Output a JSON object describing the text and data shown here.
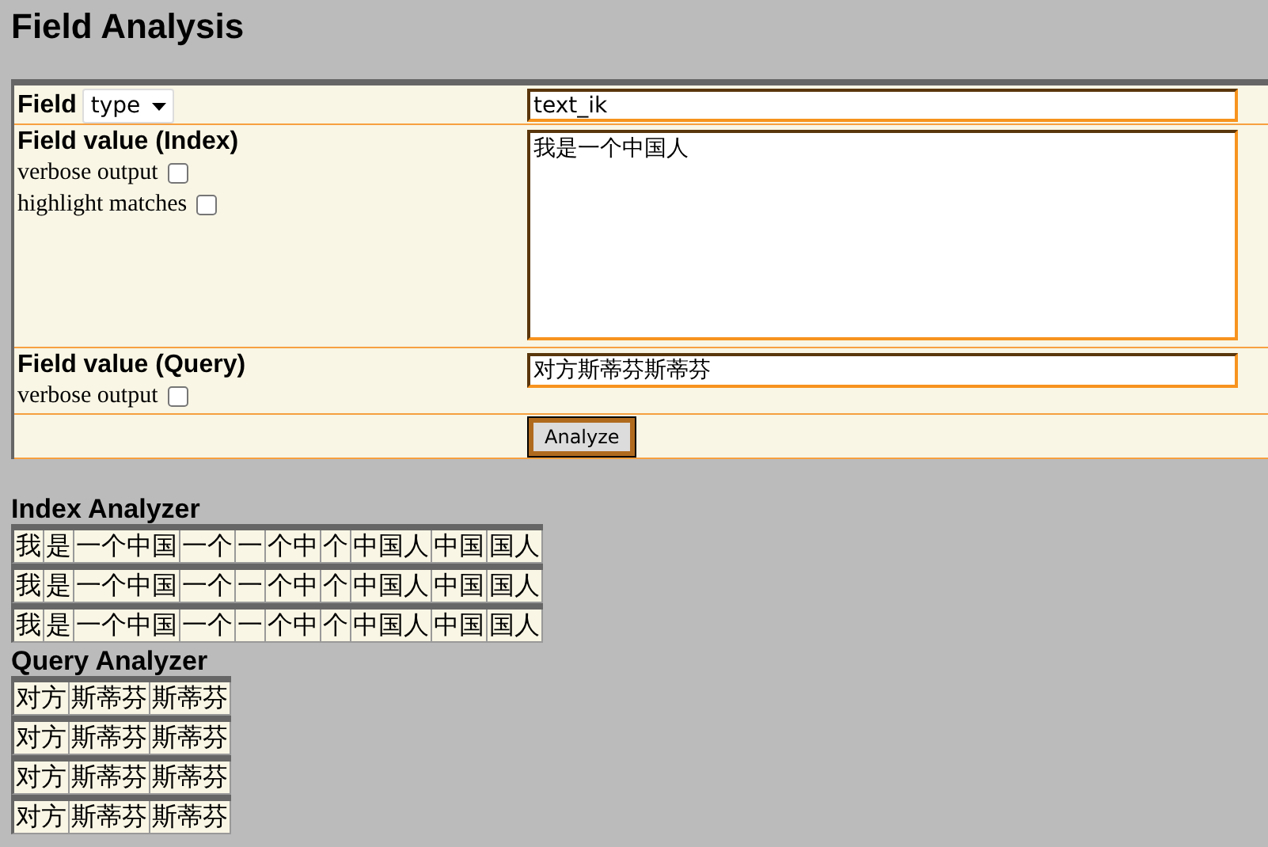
{
  "title": "Field Analysis",
  "form": {
    "field": {
      "label": "Field",
      "select_value": "type",
      "value": "text_ik"
    },
    "index": {
      "label": "Field value (Index)",
      "value": "我是一个中国人",
      "options": [
        {
          "label": "verbose output",
          "checked": false
        },
        {
          "label": "highlight matches",
          "checked": false
        }
      ]
    },
    "query": {
      "label": "Field value (Query)",
      "value": "对方斯蒂芬斯蒂芬",
      "options": [
        {
          "label": "verbose output",
          "checked": false
        }
      ]
    },
    "button": "Analyze"
  },
  "analyzers": [
    {
      "title": "Index Analyzer",
      "rows": [
        [
          "我",
          "是",
          "一个中国",
          "一个",
          "一",
          "个中",
          "个",
          "中国人",
          "中国",
          "国人"
        ],
        [
          "我",
          "是",
          "一个中国",
          "一个",
          "一",
          "个中",
          "个",
          "中国人",
          "中国",
          "国人"
        ],
        [
          "我",
          "是",
          "一个中国",
          "一个",
          "一",
          "个中",
          "个",
          "中国人",
          "中国",
          "国人"
        ]
      ]
    },
    {
      "title": "Query Analyzer",
      "rows": [
        [
          "对方",
          "斯蒂芬",
          "斯蒂芬"
        ],
        [
          "对方",
          "斯蒂芬",
          "斯蒂芬"
        ],
        [
          "对方",
          "斯蒂芬",
          "斯蒂芬"
        ],
        [
          "对方",
          "斯蒂芬",
          "斯蒂芬"
        ]
      ]
    }
  ]
}
